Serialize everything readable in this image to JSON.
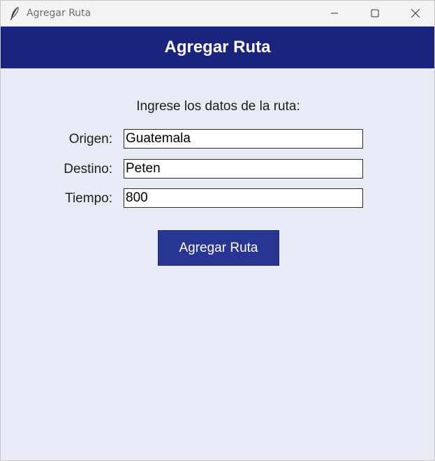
{
  "window": {
    "title": "Agregar Ruta",
    "icon": "feather-icon",
    "controls": [
      "minimize-icon",
      "maximize-icon",
      "close-icon"
    ]
  },
  "header": {
    "title": "Agregar Ruta",
    "background": "#1a237e"
  },
  "form": {
    "prompt": "Ingrese los datos de la ruta:",
    "fields": [
      {
        "label": "Origen:",
        "value": "Guatemala"
      },
      {
        "label": "Destino:",
        "value": "Peten"
      },
      {
        "label": "Tiempo:",
        "value": "800"
      }
    ],
    "submit_label": "Agregar Ruta",
    "submit_color": "#283593"
  },
  "colors": {
    "background": "#e8eaf6"
  }
}
